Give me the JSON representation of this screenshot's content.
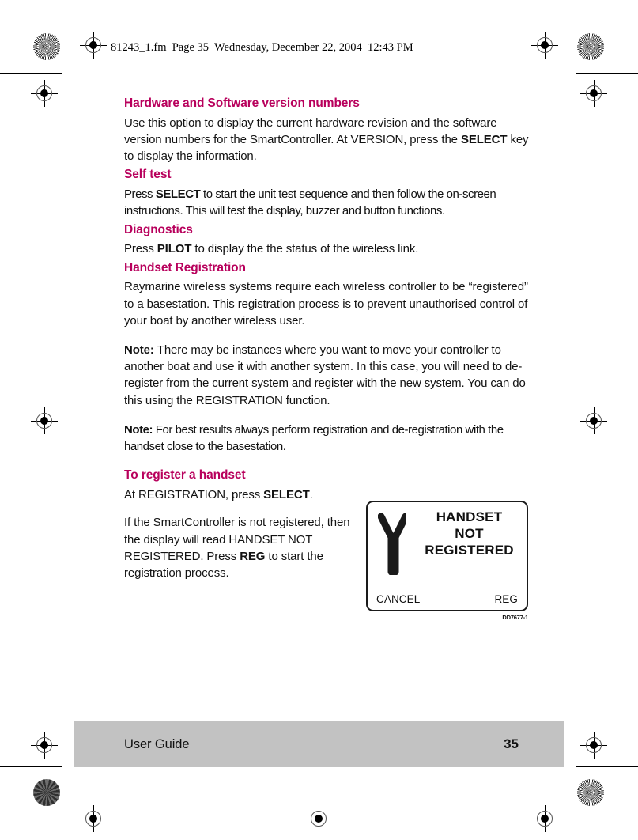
{
  "page": {
    "file_stamp": "81243_1.fm  Page 35  Wednesday, December 22, 2004  12:43 PM",
    "accent_color": "#b8005c",
    "footer_band_color": "#c2c2c2"
  },
  "sections": [
    {
      "heading": "Hardware and Software version numbers",
      "paragraphs": [
        {
          "runs": [
            {
              "text": "Use this option to display the current hardware revision and the software version numbers for the SmartController. At VERSION, press the ",
              "bold": false
            },
            {
              "text": "SELECT",
              "bold": true
            },
            {
              "text": " key to display the information.",
              "bold": false
            }
          ]
        }
      ]
    },
    {
      "heading": "Self test",
      "paragraphs": [
        {
          "runs": [
            {
              "text": "Press ",
              "bold": false
            },
            {
              "text": "SELECT",
              "bold": true
            },
            {
              "text": " to start the unit test sequence and then follow the on-screen instructions. This will test the display, buzzer and button functions.",
              "bold": false
            }
          ]
        }
      ]
    },
    {
      "heading": "Diagnostics",
      "paragraphs": [
        {
          "runs": [
            {
              "text": "Press ",
              "bold": false
            },
            {
              "text": "PILOT",
              "bold": true
            },
            {
              "text": " to display the the status of the wireless link.",
              "bold": false
            }
          ]
        }
      ]
    },
    {
      "heading": "Handset Registration",
      "paragraphs": [
        {
          "runs": [
            {
              "text": "Raymarine wireless systems require each wireless controller to be “registered” to a basestation. This registration process is to prevent unauthorised control of your boat by another wireless user.",
              "bold": false
            }
          ]
        }
      ]
    }
  ],
  "notes": [
    {
      "label": "Note:",
      "text": "There may be instances where you want to move your controller to another boat and use it with another system. In this case, you will need to de-register from the current system and register with the new system. You can do this using the REGISTRATION function."
    },
    {
      "label": "Note:",
      "text": "For best results always perform registration and de-registration with the handset close to the basestation."
    }
  ],
  "register_section": {
    "heading": "To register a handset",
    "paragraph_1": {
      "runs": [
        {
          "text": "At REGISTRATION, press ",
          "bold": false
        },
        {
          "text": "SELECT",
          "bold": true
        },
        {
          "text": ".",
          "bold": false
        }
      ]
    },
    "paragraph_2": {
      "runs": [
        {
          "text": "If the SmartController is not registered, then the display will read HANDSET NOT REGISTERED. Press ",
          "bold": false
        },
        {
          "text": "REG",
          "bold": true
        },
        {
          "text": " to start the registration process.",
          "bold": false
        }
      ]
    }
  },
  "figure": {
    "icon": "antenna-icon",
    "message_line_1": "HANDSET",
    "message_line_2": "NOT",
    "message_line_3": "REGISTERED",
    "softkey_left": "CANCEL",
    "softkey_right": "REG",
    "reference": "DD7677-1"
  },
  "footer": {
    "title": "User Guide",
    "page_number": "35"
  }
}
